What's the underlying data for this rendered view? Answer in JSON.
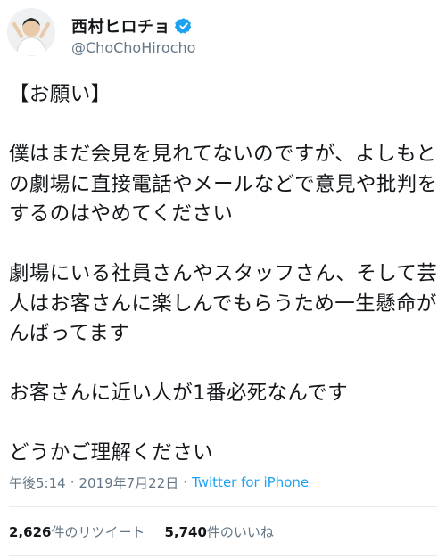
{
  "user": {
    "display_name": "西村ヒロチョ",
    "handle": "@ChoChoHirocho",
    "verified": true
  },
  "tweet": {
    "paragraphs": [
      "【お願い】",
      "僕はまだ会見を見れてないのですが、よしもとの劇場に直接電話やメールなどで意見や批判をするのはやめてください",
      "劇場にいる社員さんやスタッフさん、そして芸人はお客さんに楽しんでもらうため一生懸命がんばってます",
      "お客さんに近い人が1番必死なんです",
      "どうかご理解ください"
    ],
    "time": "午後5:14",
    "date": "2019年7月22日",
    "separator": "·",
    "source": "Twitter for iPhone"
  },
  "stats": {
    "retweets_count": "2,626",
    "retweets_label": "件のリツイート",
    "likes_count": "5,740",
    "likes_label": "件のいいね"
  },
  "colors": {
    "text": "#14171a",
    "secondary": "#657786",
    "link": "#1da1f2",
    "verified": "#1da1f2",
    "divider": "#e6ecf0"
  }
}
